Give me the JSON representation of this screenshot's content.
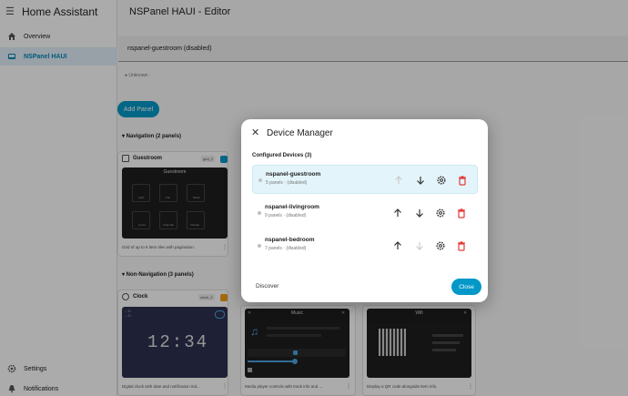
{
  "sidebar": {
    "app_title": "Home Assistant",
    "items": [
      {
        "label": "Overview",
        "icon": "home-icon"
      },
      {
        "label": "NSPanel HAUI",
        "icon": "tablet-icon",
        "active": true
      }
    ],
    "bottom_items": [
      {
        "label": "Settings",
        "icon": "gear-icon"
      },
      {
        "label": "Notifications",
        "icon": "bell-icon"
      }
    ]
  },
  "header": {
    "title": "NSPanel HAUI - Editor"
  },
  "main": {
    "device_field_value": "nspanel-guestroom (disabled)",
    "status_text": "● Unknown  ·",
    "add_panel_label": "Add Panel",
    "navigation_section": "▾ Navigation (2 panels)",
    "non_navigation_section": "▾ Non-Navigation (3 panels)",
    "guestroom_card": {
      "title": "Guestroom",
      "badge": "grid_2",
      "preview_title": "Guestroom",
      "tiles": [
        "Light",
        "Fan",
        "Music",
        "Cover",
        "Calendar",
        "Climate"
      ],
      "description": "Grid of up to 6 item tiles with pagination."
    },
    "clock_card": {
      "title": "Clock",
      "badge": "clock_2",
      "time": "12:34",
      "left_top": "-- 31",
      "left_top2": "-- 31",
      "description": "Digital clock with date and notification ind..."
    },
    "music_card": {
      "preview_title": "Music",
      "description": "Media player controls with track info and ..."
    },
    "wifi_card": {
      "preview_title": "Wifi",
      "description": "Display a QR code alongside item info."
    }
  },
  "dialog": {
    "title": "Device Manager",
    "configured_label": "Configured Devices (3)",
    "devices": [
      {
        "name": "nspanel-guestroom",
        "meta": "5 panels · (disabled)",
        "selected": true
      },
      {
        "name": "nspanel-livingroom",
        "meta": "9 panels · (disabled)",
        "selected": false
      },
      {
        "name": "nspanel-bedroom",
        "meta": "7 panels · (disabled)",
        "selected": false
      }
    ],
    "discover_label": "Discover",
    "close_label": "Close"
  },
  "colors": {
    "accent": "#0398c8",
    "danger": "#e53935",
    "selected_row": "#e3f5fa"
  }
}
